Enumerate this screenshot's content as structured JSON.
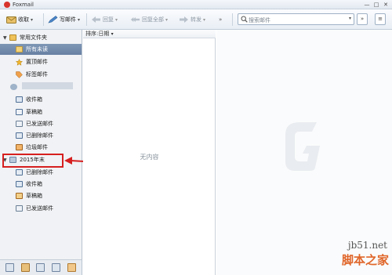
{
  "window": {
    "title": "Foxmail",
    "controls": [
      "—",
      "□",
      "✕"
    ]
  },
  "toolbar": {
    "receive": "收取",
    "compose": "写邮件",
    "reply": "回复",
    "reply_all": "回复全部",
    "forward": "转发",
    "more": "»",
    "search_placeholder": "搜索邮件",
    "search_dropdown": "▾",
    "expand_button": "»",
    "menu_button": "≡"
  },
  "sidebar": {
    "common_folders": "常用文件夹",
    "items_top": [
      "所有未读",
      "置顶邮件",
      "标签邮件"
    ],
    "account_items": [
      "收件箱",
      "草稿箱",
      "已发送邮件",
      "已删除邮件",
      "垃圾邮件"
    ],
    "archive_folder": "2015年末",
    "archive_items": [
      "已删除邮件",
      "收件箱",
      "草稿箱",
      "已发送邮件"
    ]
  },
  "list": {
    "sort_label": "排序:日期",
    "empty_text": "无内容"
  },
  "watermark": {
    "site": "jb51.net",
    "brand": "脚本之家"
  },
  "colors": {
    "highlight": "#d61f1f",
    "selected": "#6f88a9",
    "watermark_brand": "#e0662a"
  },
  "icons": [
    "foxmail-logo-icon",
    "receive-icon",
    "compose-icon",
    "reply-icon",
    "reply-all-icon",
    "forward-icon",
    "search-icon",
    "folder-icon",
    "star-icon",
    "tag-icon",
    "inbox-icon",
    "drafts-icon",
    "sent-icon",
    "trash-icon",
    "spam-icon",
    "account-icon"
  ]
}
